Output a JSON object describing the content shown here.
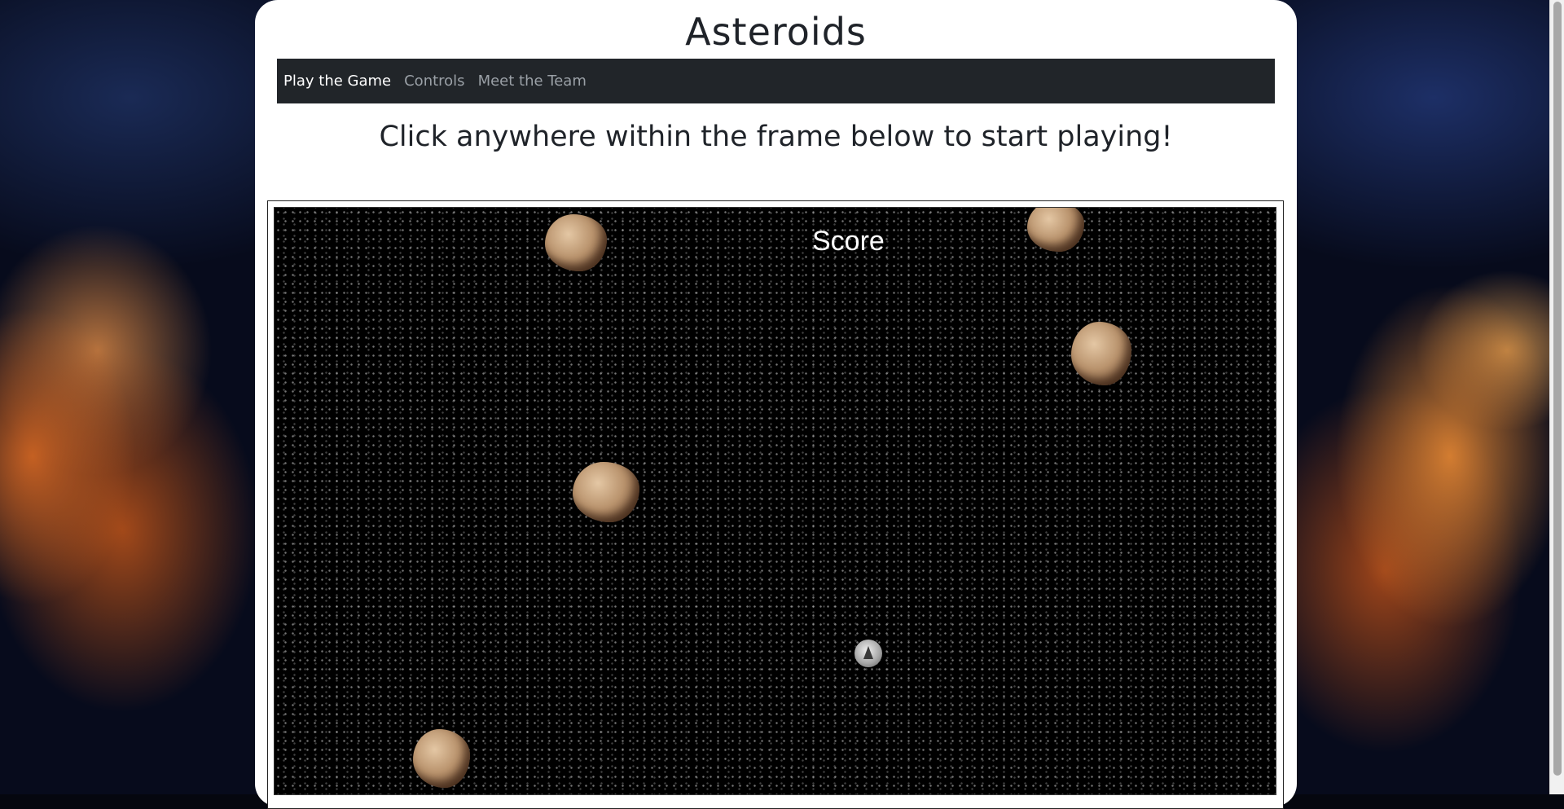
{
  "site": {
    "title": "Asteroids"
  },
  "nav": {
    "items": [
      {
        "label": "Play the Game",
        "active": true
      },
      {
        "label": "Controls",
        "active": false
      },
      {
        "label": "Meet the Team",
        "active": false
      }
    ]
  },
  "instruction": "Click anywhere within the frame below to start playing!",
  "game": {
    "score_label": "Score",
    "background": "starfield",
    "asteroid_icon": "asteroid-icon",
    "ship_icon": "spaceship-icon"
  },
  "colors": {
    "navbar": "#212529",
    "nav_active": "#ffffff",
    "nav_inactive": "#9aa0a6",
    "panel": "#ffffff",
    "canvas": "#000000"
  }
}
